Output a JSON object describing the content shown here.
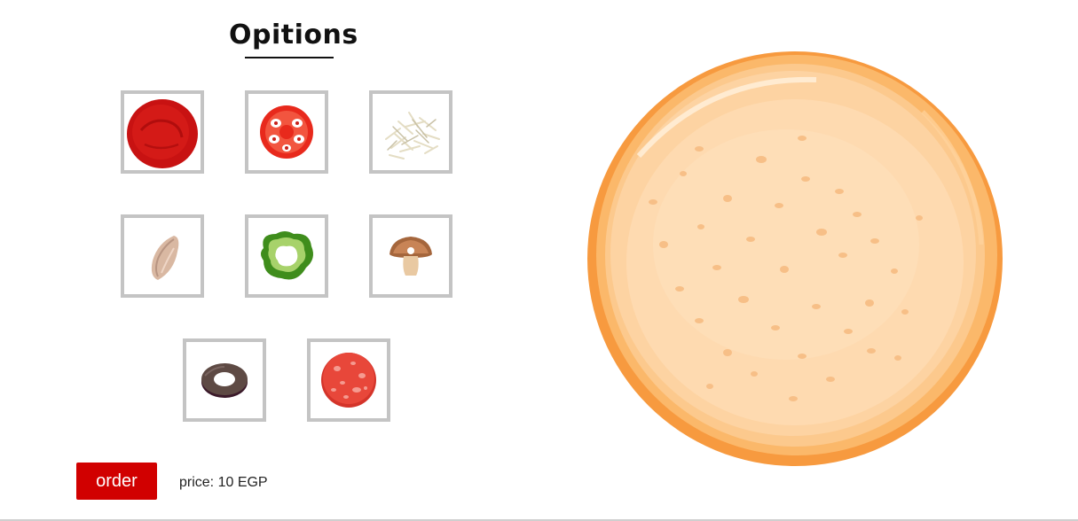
{
  "header": {
    "title": "Opitions"
  },
  "toppings": [
    {
      "id": "sauce",
      "icon": "tomato-sauce-icon"
    },
    {
      "id": "tomato",
      "icon": "tomato-slice-icon"
    },
    {
      "id": "cheese",
      "icon": "shredded-cheese-icon"
    },
    {
      "id": "chicken",
      "icon": "chicken-icon"
    },
    {
      "id": "pepper",
      "icon": "green-pepper-icon"
    },
    {
      "id": "mushroom",
      "icon": "mushroom-icon"
    },
    {
      "id": "olive",
      "icon": "black-olive-icon"
    },
    {
      "id": "pepperoni",
      "icon": "pepperoni-icon"
    }
  ],
  "footer": {
    "order_label": "order",
    "price_text": "price: 10 EGP"
  },
  "canvas": {
    "pizza": "pizza-dough-base"
  },
  "colors": {
    "accent": "#d10000",
    "tile_border": "#c4c4c4"
  }
}
